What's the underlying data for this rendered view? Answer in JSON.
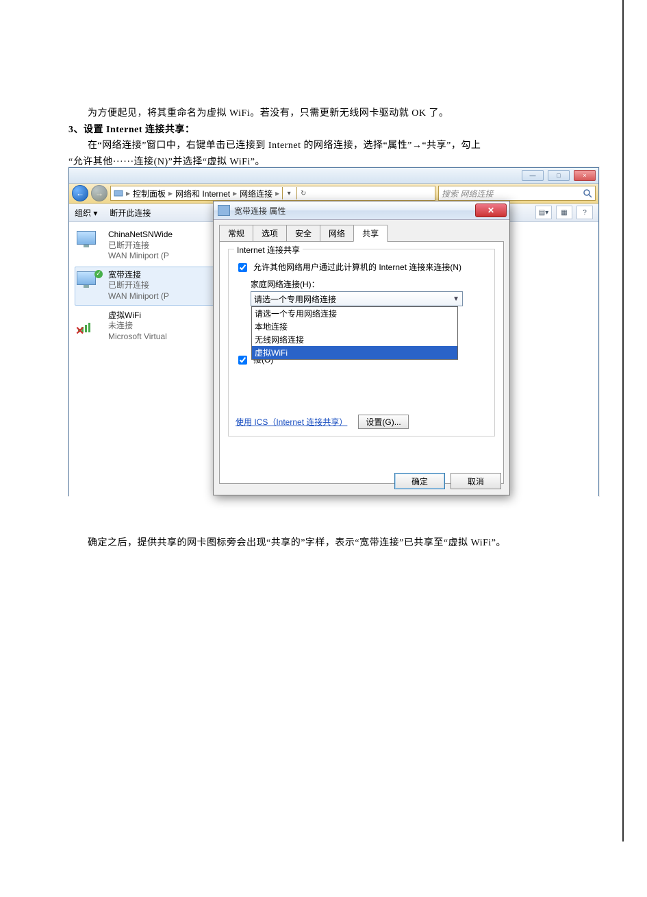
{
  "doc": {
    "para1": "为方便起见，将其重命名为虚拟 WiFi。若没有，只需更新无线网卡驱动就 OK 了。",
    "step_label": "3、设置 Internet 连接共享：",
    "para2_a": "在“网络连接”窗口中，右键单击已连接到 Internet 的网络连接，选择“属性”→“共享”，勾上",
    "para2_b": "“允许其他······连接(N)”并选择“虚拟 WiFi”。",
    "after": "确定之后，提供共享的网卡图标旁会出现“共享的”字样，表示“宽带连接”已共享至“虚拟 WiFi”。"
  },
  "explorer": {
    "win_min": "—",
    "win_max": "□",
    "win_close": "×",
    "nav_back": "←",
    "nav_fwd": "→",
    "crumbs": [
      "控制面板",
      "网络和 Internet",
      "网络连接"
    ],
    "crumb_sep": "▸",
    "crumb_refresh": "↻",
    "search_placeholder": "搜索 网络连接",
    "toolbar_org": "组织 ▾",
    "toolbar_disconnect": "断开此连接",
    "view_icon": "▤",
    "layout_icon": "▦",
    "help_icon": "?",
    "conns": [
      {
        "name": "ChinaNetSNWide",
        "status": "已断开连接",
        "adapter": "WAN Miniport (P"
      },
      {
        "name": "宽带连接",
        "status": "已断开连接",
        "adapter": "WAN Miniport (P"
      },
      {
        "name": "虚拟WiFi",
        "status": "未连接",
        "adapter": "Microsoft Virtual"
      }
    ]
  },
  "dialog": {
    "title": "宽带连接 属性",
    "tabs": [
      "常规",
      "选项",
      "安全",
      "网络",
      "共享"
    ],
    "group_legend": "Internet 连接共享",
    "chk_allow": "允许其他网络用户通过此计算机的 Internet 连接来连接(N)",
    "home_label": "家庭网络连接(H)：",
    "dd_selected": "请选一个专用网络连接",
    "dd_options": [
      "请选一个专用网络连接",
      "本地连接",
      "无线网络连接",
      "虚拟WiFi"
    ],
    "chk_control_prefix": "接(O)",
    "link_ics": "使用 ICS（Internet 连接共享）",
    "btn_settings": "设置(G)...",
    "btn_ok": "确定",
    "btn_cancel": "取消"
  }
}
